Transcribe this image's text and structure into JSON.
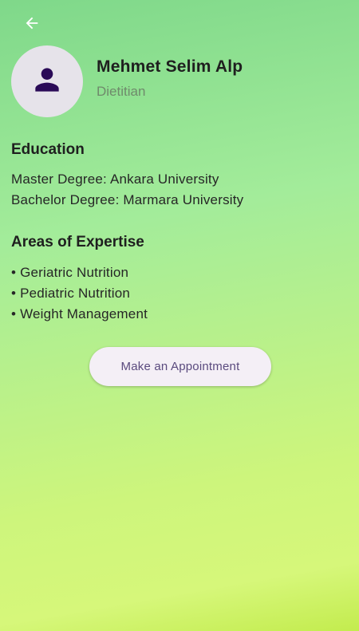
{
  "header": {
    "back_icon": "arrow-left-icon"
  },
  "profile": {
    "avatar_icon": "person-icon",
    "name": "Mehmet Selim Alp",
    "title": "Dietitian"
  },
  "education": {
    "heading": "Education",
    "items": [
      "Master Degree: Ankara University",
      "Bachelor Degree: Marmara University"
    ]
  },
  "expertise": {
    "heading": "Areas of Expertise",
    "items": [
      "• Geriatric Nutrition",
      "• Pediatric Nutrition",
      "• Weight Management"
    ]
  },
  "actions": {
    "appointment_label": "Make an Appointment"
  },
  "colors": {
    "avatar_bg": "#e6e3ea",
    "avatar_icon": "#2a0a57",
    "button_bg": "#f4eff6",
    "button_text": "#5a4a7e"
  }
}
